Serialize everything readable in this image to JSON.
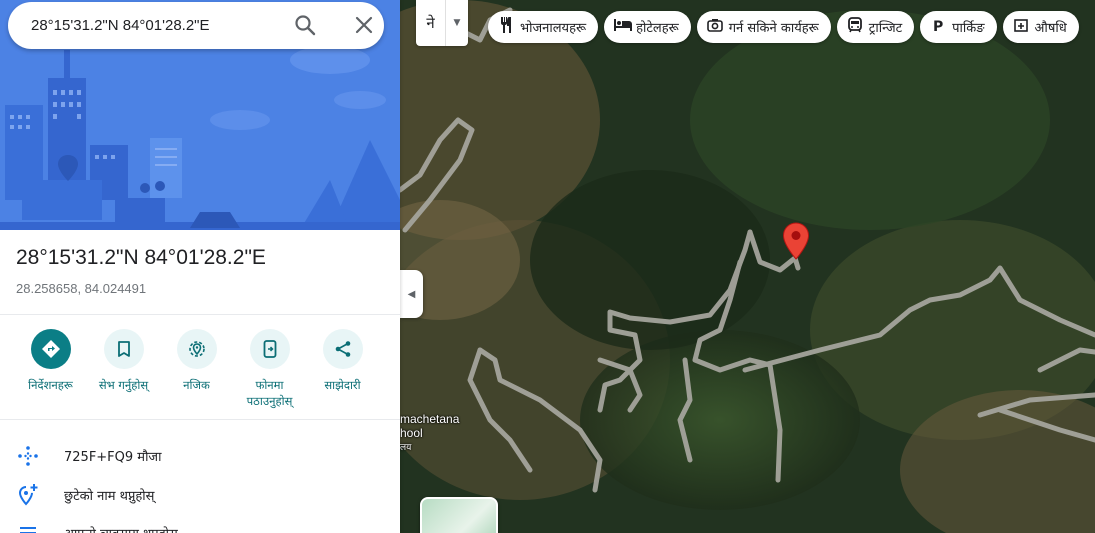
{
  "search": {
    "value": "28°15'31.2\"N 84°01'28.2\"E",
    "icon": "search-icon",
    "clear_icon": "close-icon"
  },
  "place": {
    "title": "28°15'31.2\"N 84°01'28.2\"E",
    "decimal_coords": "28.258658, 84.024491"
  },
  "actions": [
    {
      "label": "निर्देशनहरू",
      "icon": "directions-icon"
    },
    {
      "label": "सेभ गर्नुहोस्",
      "icon": "bookmark-icon"
    },
    {
      "label": "नजिक",
      "icon": "nearby-icon"
    },
    {
      "label": "फोनमा पठाउनुहोस्",
      "icon": "send-to-phone-icon"
    },
    {
      "label": "साझेदारी",
      "icon": "share-icon"
    }
  ],
  "info_rows": [
    {
      "text": "725F+FQ9 मौजा",
      "icon": "plus-code-icon"
    },
    {
      "text": "छुटेको नाम थप्नुहोस्",
      "icon": "add-place-icon"
    },
    {
      "text": "आफ्नो व्यवसाय थप्नुहोस्",
      "icon": "list-icon"
    }
  ],
  "map": {
    "layer_lang": "ने",
    "chips": [
      {
        "label": "भोजनालयहरू",
        "icon": "restaurant-icon"
      },
      {
        "label": "होटेलहरू",
        "icon": "hotel-icon"
      },
      {
        "label": "गर्न सकिने कार्यहरू",
        "icon": "camera-icon"
      },
      {
        "label": "ट्रान्जिट",
        "icon": "transit-icon"
      },
      {
        "label": "पार्किङ",
        "icon": "parking-icon"
      },
      {
        "label": "औषधि",
        "icon": "pharmacy-icon"
      }
    ],
    "label_line1": "machetana",
    "label_line2": "hool",
    "label_line3": "लय"
  },
  "colors": {
    "accent": "#0b7e86",
    "pin": "#ea4335",
    "hero_bg": "#4c82e4"
  }
}
